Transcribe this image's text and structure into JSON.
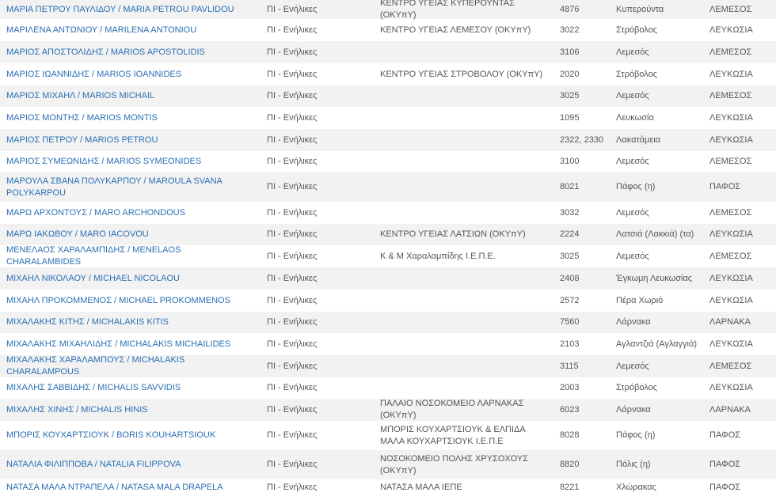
{
  "rows": [
    {
      "name": "ΜΑΡΙΑ ΠΕΤΡΟΥ ΠΑΥΛΙΔΟΥ / MARIA PETROU PAVLIDOU",
      "specialty": "ΠΙ - Ενήλικες",
      "provider": "ΚΕΝΤΡΟ ΥΓΕΙΑΣ ΚΥΠΕΡΟΥΝΤΑΣ (ΟΚΥπΥ)",
      "postcode": "4876",
      "area": "Κυπερούντα",
      "district": "ΛΕΜΕΣΟΣ"
    },
    {
      "name": "ΜΑΡΙΛΕΝΑ ΑΝΤΩΝΙΟΥ / MARILENA ANTONIOU",
      "specialty": "ΠΙ - Ενήλικες",
      "provider": "ΚΕΝΤΡΟ ΥΓΕΙΑΣ ΛΕΜΕΣΟΥ (ΟΚΥπΥ)",
      "postcode": "3022",
      "area": "Στρόβολος",
      "district": "ΛΕΥΚΩΣΙΑ"
    },
    {
      "name": "ΜΑΡΙΟΣ ΑΠΟΣΤΟΛΙΔΗΣ / MARIOS APOSTOLIDIS",
      "specialty": "ΠΙ - Ενήλικες",
      "provider": "",
      "postcode": "3106",
      "area": "Λεμεσός",
      "district": "ΛΕΜΕΣΟΣ"
    },
    {
      "name": "ΜΑΡΙΟΣ ΙΩΑΝΝΙΔΗΣ / MARIOS IOANNIDES",
      "specialty": "ΠΙ - Ενήλικες",
      "provider": "ΚΕΝΤΡΟ ΥΓΕΙΑΣ ΣΤΡΟΒΟΛΟΥ (ΟΚΥπΥ)",
      "postcode": "2020",
      "area": "Στρόβολος",
      "district": "ΛΕΥΚΩΣΙΑ"
    },
    {
      "name": "ΜΑΡΙΟΣ ΜΙΧΑΗΛ / MARIOS MICHAIL",
      "specialty": "ΠΙ - Ενήλικες",
      "provider": "",
      "postcode": "3025",
      "area": "Λεμεσός",
      "district": "ΛΕΜΕΣΟΣ"
    },
    {
      "name": "ΜΑΡΙΟΣ ΜΟΝΤΗΣ / MARIOS MONTIS",
      "specialty": "ΠΙ - Ενήλικες",
      "provider": "",
      "postcode": "1095",
      "area": "Λευκωσία",
      "district": "ΛΕΥΚΩΣΙΑ"
    },
    {
      "name": "ΜΑΡΙΟΣ ΠΕΤΡΟΥ / MARIOS PETROU",
      "specialty": "ΠΙ - Ενήλικες",
      "provider": "",
      "postcode": "2322, 2330",
      "area": "Λακατάμεια",
      "district": "ΛΕΥΚΩΣΙΑ"
    },
    {
      "name": "ΜΑΡΙΟΣ ΣΥΜΕΩΝΙΔΗΣ / MARIOS SYMEONIDES",
      "specialty": "ΠΙ - Ενήλικες",
      "provider": "",
      "postcode": "3100",
      "area": "Λεμεσός",
      "district": "ΛΕΜΕΣΟΣ"
    },
    {
      "name": "ΜΑΡΟΥΛΑ ΣΒΑΝΑ ΠΟΛΥΚΑΡΠΟΥ / MAROULA SVANA POLYKARPOU",
      "specialty": "ΠΙ - Ενήλικες",
      "provider": "",
      "postcode": "8021",
      "area": "Πάφος (η)",
      "district": "ΠΑΦΟΣ"
    },
    {
      "name": "ΜΑΡΩ ΑΡΧΟΝΤΟΥΣ / MARO ARCHONDOUS",
      "specialty": "ΠΙ - Ενήλικες",
      "provider": "",
      "postcode": "3032",
      "area": "Λεμεσός",
      "district": "ΛΕΜΕΣΟΣ"
    },
    {
      "name": "ΜΑΡΩ ΙΑΚΩΒΟΥ / MARO IACOVOU",
      "specialty": "ΠΙ - Ενήλικες",
      "provider": "ΚΕΝΤΡΟ ΥΓΕΙΑΣ ΛΑΤΣΙΩΝ (ΟΚΥπΥ)",
      "postcode": "2224",
      "area": "Λατσιά (Λακκιά) (τα)",
      "district": "ΛΕΥΚΩΣΙΑ"
    },
    {
      "name": "ΜΕΝΕΛΑΟΣ ΧΑΡΑΛΑΜΠΙΔΗΣ / MENELAOS CHARALAMBIDES",
      "specialty": "ΠΙ - Ενήλικες",
      "provider": "Κ & Μ Χαραλαμπίδης Ι.Ε.Π.Ε.",
      "postcode": "3025",
      "area": "Λεμεσός",
      "district": "ΛΕΜΕΣΟΣ"
    },
    {
      "name": "ΜΙΧΑΗΛ ΝΙΚΟΛΑΟΥ / MICHAEL NICOLAOU",
      "specialty": "ΠΙ - Ενήλικες",
      "provider": "",
      "postcode": "2408",
      "area": "Έγκωμη Λευκωσίας",
      "district": "ΛΕΥΚΩΣΙΑ"
    },
    {
      "name": "ΜΙΧΑΗΛ ΠΡΟΚΟΜΜΕΝΟΣ / MICHAEL PROKOMMENOS",
      "specialty": "ΠΙ - Ενήλικες",
      "provider": "",
      "postcode": "2572",
      "area": "Πέρα Χωριό",
      "district": "ΛΕΥΚΩΣΙΑ"
    },
    {
      "name": "ΜΙΧΑΛΑΚΗΣ ΚΙΤΗΣ / MICHALAKIS KITIS",
      "specialty": "ΠΙ - Ενήλικες",
      "provider": "",
      "postcode": "7560",
      "area": "Λάρνακα",
      "district": "ΛΑΡΝΑΚΑ"
    },
    {
      "name": "ΜΙΧΑΛΑΚΗΣ ΜΙΧΑΗΛΙΔΗΣ / MICHALAKIS MICHAILIDES",
      "specialty": "ΠΙ - Ενήλικες",
      "provider": "",
      "postcode": "2103",
      "area": "Αγλαντζιά (Αγλαγγιά)",
      "district": "ΛΕΥΚΩΣΙΑ"
    },
    {
      "name": "ΜΙΧΑΛΑΚΗΣ ΧΑΡΑΛΑΜΠΟΥΣ / MICHALAKIS CHARALAMPOUS",
      "specialty": "ΠΙ - Ενήλικες",
      "provider": "",
      "postcode": "3115",
      "area": "Λεμεσός",
      "district": "ΛΕΜΕΣΟΣ"
    },
    {
      "name": "ΜΙΧΑΛΗΣ ΣΑΒΒΙΔΗΣ / MICHALIS SAVVIDIS",
      "specialty": "ΠΙ - Ενήλικες",
      "provider": "",
      "postcode": "2003",
      "area": "Στρόβολος",
      "district": "ΛΕΥΚΩΣΙΑ"
    },
    {
      "name": "ΜΙΧΑΛΗΣ ΧΙΝΗΣ / MICHALIS HINIS",
      "specialty": "ΠΙ - Ενήλικες",
      "provider": "ΠΑΛΑΙΟ ΝΟΣΟΚΟΜΕΙΟ ΛΑΡΝΑΚΑΣ (ΟΚΥπΥ)",
      "postcode": "6023",
      "area": "Λάρνακα",
      "district": "ΛΑΡΝΑΚΑ"
    },
    {
      "name": "ΜΠΟΡΙΣ ΚΟΥΧΑΡΤΣΙΟΥΚ / BORIS KOUHARTSIOUK",
      "specialty": "ΠΙ - Ενήλικες",
      "provider": "ΜΠΟΡΙΣ ΚΟΥΧΑΡΤΣΙΟΥΚ & ΕΛΠΙΔΑ ΜΑΛΑ ΚΟΥΧΑΡΤΣΙΟΥΚ Ι.Ε.Π.Ε",
      "postcode": "8028",
      "area": "Πάφος (η)",
      "district": "ΠΑΦΟΣ"
    },
    {
      "name": "ΝΑΤΑΛΙΑ ΦΙΛΙΠΠΟΒΑ / NATALIA FILIPPOVA",
      "specialty": "ΠΙ - Ενήλικες",
      "provider": "ΝΟΣΟΚΟΜΕΙΟ ΠΟΛΗΣ ΧΡΥΣΟΧΟΥΣ (ΟΚΥπΥ)",
      "postcode": "8820",
      "area": "Πόλις (η)",
      "district": "ΠΑΦΟΣ"
    },
    {
      "name": "ΝΑΤΑΣΑ ΜΑΛΑ ΝΤΡΑΠΕΛΑ / NATASA MALA DRAPELA",
      "specialty": "ΠΙ - Ενήλικες",
      "provider": "ΝΑΤΑΣΑ ΜΑΛΑ ΙΕΠΕ",
      "postcode": "8221",
      "area": "Χλώρακας",
      "district": "ΠΑΦΟΣ"
    }
  ]
}
